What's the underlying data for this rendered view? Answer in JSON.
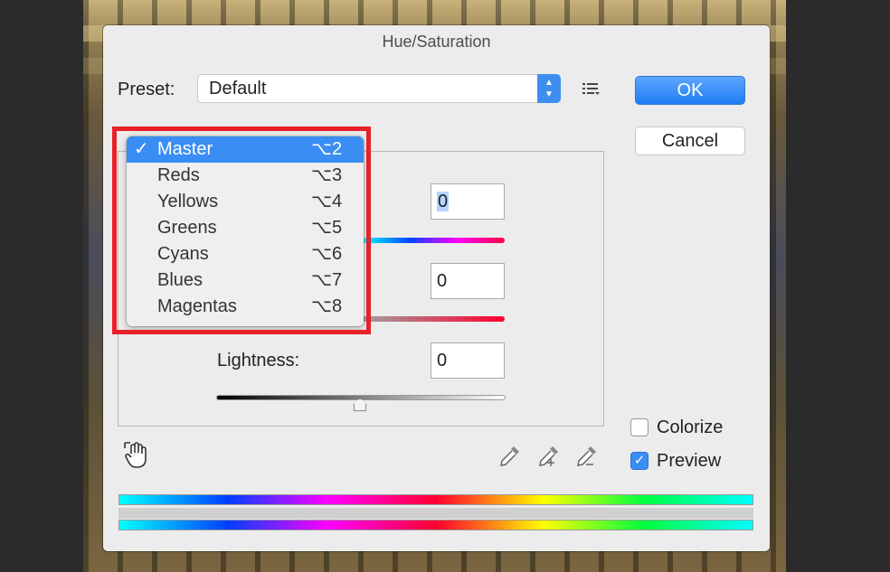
{
  "dialog": {
    "title": "Hue/Saturation",
    "preset_label": "Preset:",
    "preset_value": "Default",
    "ok_label": "OK",
    "cancel_label": "Cancel"
  },
  "fields": {
    "hue_value": "0",
    "saturation_value": "0",
    "lightness_label": "Lightness:",
    "lightness_value": "0"
  },
  "channel_menu": {
    "items": [
      {
        "label": "Master",
        "shortcut": "⌥2",
        "checked": true
      },
      {
        "label": "Reds",
        "shortcut": "⌥3"
      },
      {
        "label": "Yellows",
        "shortcut": "⌥4"
      },
      {
        "label": "Greens",
        "shortcut": "⌥5"
      },
      {
        "label": "Cyans",
        "shortcut": "⌥6"
      },
      {
        "label": "Blues",
        "shortcut": "⌥7"
      },
      {
        "label": "Magentas",
        "shortcut": "⌥8"
      }
    ],
    "check_mark": "✓"
  },
  "options": {
    "colorize_label": "Colorize",
    "colorize_checked": false,
    "preview_label": "Preview",
    "preview_checked": true
  },
  "colors": {
    "accent": "#3a8ef3",
    "highlight_box": "#e8202a"
  },
  "icons": {
    "hand": "targeted-adjustment-hand-icon",
    "eyedropper": "eyedropper-icon",
    "eyedropper_plus": "eyedropper-plus-icon",
    "eyedropper_minus": "eyedropper-minus-icon",
    "preset_options": "preset-options-menu-icon"
  }
}
